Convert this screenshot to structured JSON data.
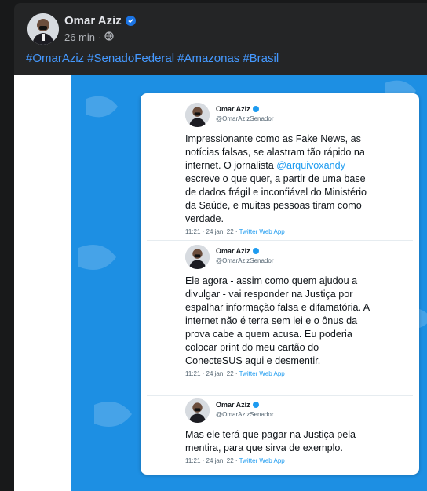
{
  "post": {
    "author": "Omar Aziz",
    "time": "26 min",
    "separator": "·",
    "privacy_icon": "globe-icon",
    "verified_icon": "verified-badge-icon",
    "hashtags": [
      "#OmarAziz",
      "#SenadoFederal",
      "#Amazonas",
      "#Brasil"
    ]
  },
  "colors": {
    "background": "#18191a",
    "card": "#242526",
    "link": "#4599ff",
    "media_blue": "#1d8fe3",
    "twitter_blue": "#1d9bf0"
  },
  "tweets": [
    {
      "name": "Omar Aziz",
      "handle": "@OmarAzizSenador",
      "text_before": "Impressionante como as Fake News, as notícias falsas, se alastram tão rápido na internet. O jornalista ",
      "mention": "@arquivoxandy",
      "text_after": " escreve o que quer, a partir de uma base de dados frágil e inconfiável do Ministério da Saúde, e muitas pessoas tiram como verdade.",
      "time": "11:21 · 24 jan. 22 · ",
      "app": "Twitter Web App"
    },
    {
      "name": "Omar Aziz",
      "handle": "@OmarAzizSenador",
      "text_before": "Ele agora - assim como quem ajudou a divulgar - vai responder na Justiça por espalhar  informação falsa e difamatória. A internet não é terra sem lei e o ônus da prova cabe a quem acusa. Eu poderia colocar print do meu cartão do ConecteSUS aqui e desmentir.",
      "mention": "",
      "text_after": "",
      "time": "11:21 · 24 jan. 22 · ",
      "app": "Twitter Web App"
    },
    {
      "name": "Omar Aziz",
      "handle": "@OmarAzizSenador",
      "text_before": "Mas ele terá que pagar na Justiça pela mentira, para que sirva de exemplo.",
      "mention": "",
      "text_after": "",
      "time": "11:21 · 24 jan. 22 · ",
      "app": "Twitter Web App"
    }
  ]
}
